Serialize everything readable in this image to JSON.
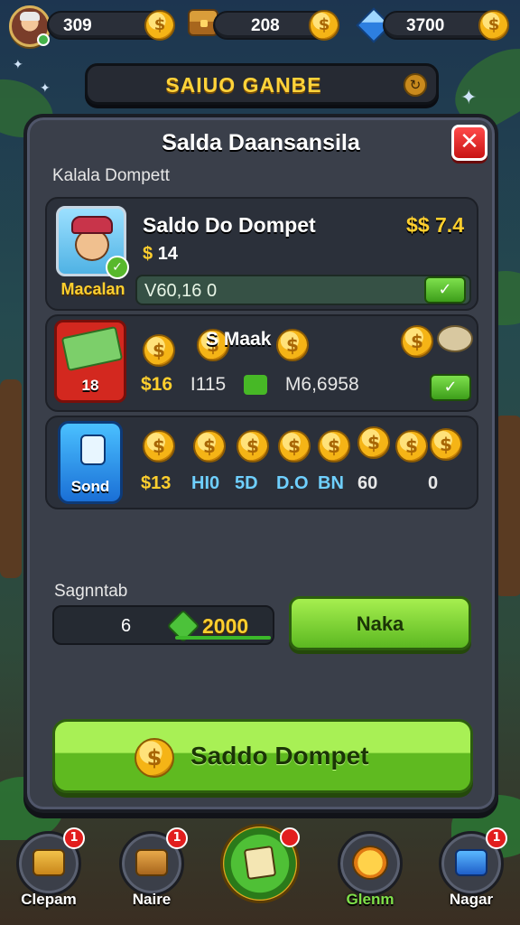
{
  "topbar": {
    "currencies": [
      {
        "value": "309",
        "icon": "coin-icon"
      },
      {
        "value": "208",
        "icon": "chest-icon"
      },
      {
        "value": "3700",
        "icon": "gem-icon"
      }
    ]
  },
  "banner": {
    "title": "SAIUO GANBE"
  },
  "panel": {
    "title": "Salda Daansansila",
    "subtitle": "Kalala Dompett",
    "close_label": "✕"
  },
  "card1": {
    "portrait_label": "Macalan",
    "title": "Saldo Do Dompet",
    "amount": "$$ 7.4",
    "sub_symbol": "$",
    "sub_value": "14",
    "bar_value": "V60,16 0"
  },
  "card2": {
    "badge_num": "18",
    "title": "S  Maak",
    "stat_a": "$16",
    "stat_b": "I115",
    "stat_c": "M6,6958"
  },
  "card3": {
    "icon_label": "Sond",
    "stat_1": "$13",
    "stat_2": "HI0",
    "stat_3": "5D",
    "stat_4": "D.O",
    "stat_5": "BN",
    "stat_6": "60",
    "stat_7": "0"
  },
  "amount_section": {
    "label": "Sagnntab",
    "quantity": "6",
    "amount": "2000",
    "next_label": "Naka"
  },
  "main_button": {
    "label": "Saddo Dompet"
  },
  "nav": {
    "items": [
      {
        "label": "Clepam",
        "badge": "1"
      },
      {
        "label": "Naire",
        "badge": "1"
      },
      {
        "label": "Glenm",
        "badge": ""
      },
      {
        "label": "Nagar",
        "badge": "1"
      }
    ]
  },
  "colors": {
    "accent_gold": "#ffcf2e",
    "accent_green": "#5cb821",
    "close_red": "#d81e1e",
    "panel": "#3a3f4a"
  }
}
